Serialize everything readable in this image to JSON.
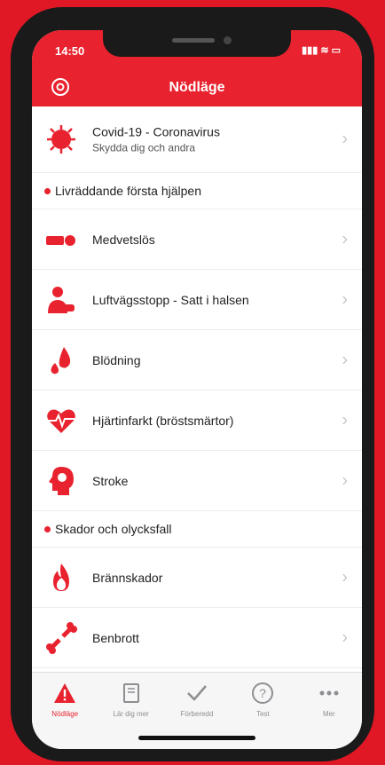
{
  "status": {
    "time": "14:50",
    "icons": "▮▮▮ ≋ ▭"
  },
  "header": {
    "title": "Nödläge"
  },
  "covid": {
    "title": "Covid-19 - Coronavirus",
    "subtitle": "Skydda dig och andra"
  },
  "sections": [
    {
      "title": "Livräddande första hjälpen"
    },
    {
      "title": "Skador och olycksfall"
    }
  ],
  "rows": [
    {
      "label": "Medvetslös"
    },
    {
      "label": "Luftvägsstopp - Satt i halsen"
    },
    {
      "label": "Blödning"
    },
    {
      "label": "Hjärtinfarkt (bröstsmärtor)"
    },
    {
      "label": "Stroke"
    },
    {
      "label": "Brännskador"
    },
    {
      "label": "Benbrott"
    }
  ],
  "chevron": "›",
  "tabs": [
    {
      "label": "Nödläge",
      "icon": "warning-icon"
    },
    {
      "label": "Lär dig mer",
      "icon": "book-icon"
    },
    {
      "label": "Förberedd",
      "icon": "checkmark-icon"
    },
    {
      "label": "Test",
      "icon": "question-icon"
    },
    {
      "label": "Mer",
      "icon": "more-icon"
    }
  ],
  "colors": {
    "accent": "#e8222e",
    "background": "#e01826"
  }
}
